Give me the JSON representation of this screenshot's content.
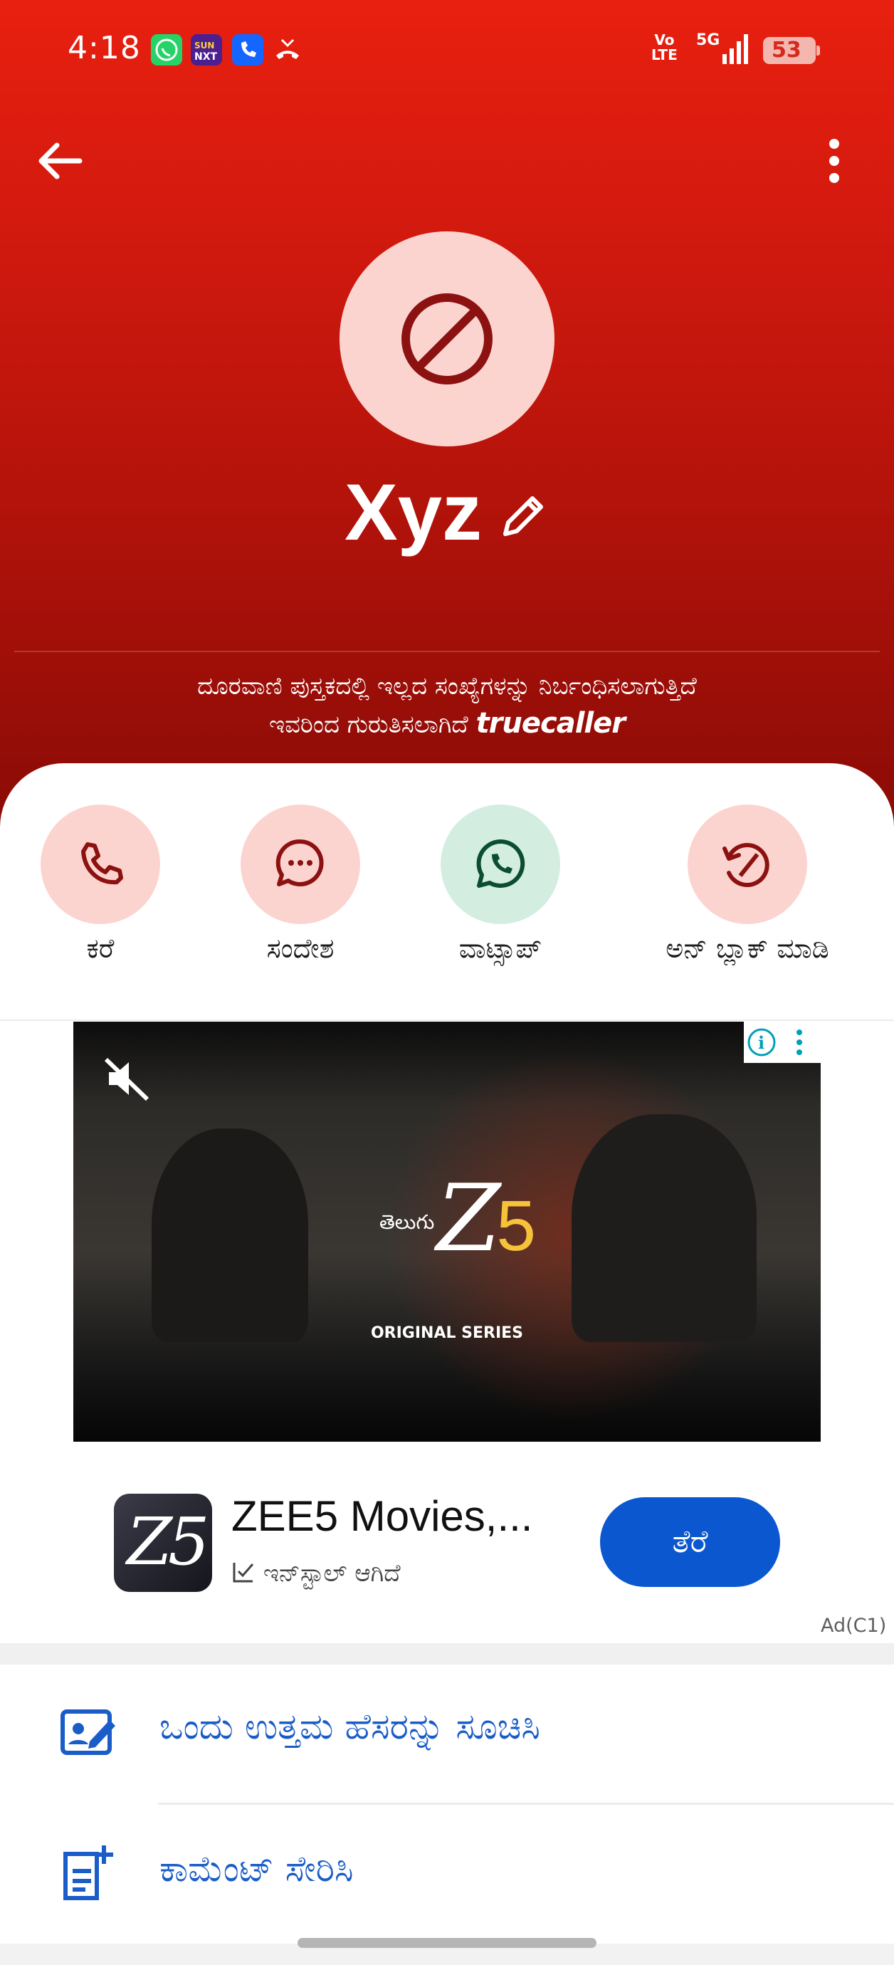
{
  "status_bar": {
    "time": "4:18",
    "network_top": "Vo",
    "network_bottom": "LTE",
    "signal": "5G",
    "battery": "53",
    "notification_icons": [
      "whatsapp-icon",
      "sun-nxt-icon",
      "truecaller-icon",
      "missed-call-icon"
    ]
  },
  "contact": {
    "name": "Xyz",
    "spam_line1": "ದೂರವಾಣಿ ಪುಸ್ತಕದಲ್ಲಿ ಇಲ್ಲದ ಸಂಖ್ಯೆಗಳನ್ನು ನಿರ್ಬಂಧಿಸಲಾಗುತ್ತಿದೆ",
    "spam_line2": "ಇವರಿಂದ ಗುರುತಿಸಲಾಗಿದೆ",
    "identified_by": "truecaller"
  },
  "actions": [
    {
      "label": "ಕರೆ",
      "icon": "phone-icon"
    },
    {
      "label": "ಸಂದೇಶ",
      "icon": "message-icon"
    },
    {
      "label": "ವಾಟ್ಸಾಪ್",
      "icon": "whatsapp-icon"
    },
    {
      "label": "ಅನ್ ಬ್ಲಾಕ್ ಮಾಡಿ",
      "icon": "unblock-icon"
    }
  ],
  "ad": {
    "video_language": "తెలుగు",
    "video_series": "ORIGINAL SERIES",
    "app_name": "ZEE5 Movies,...",
    "install_status": "ಇನ್‌ಸ್ಟಾಲ್ ಆಗಿದೆ",
    "open_button": "ತೆರೆ",
    "ad_tag": "Ad(C1)"
  },
  "options": [
    {
      "label": "ಒಂದು ಉತ್ತಮ ಹೆಸರನ್ನು ಸೂಚಿಸಿ",
      "icon": "suggest-name-icon"
    },
    {
      "label": "ಕಾಮೆಂಟ್ ಸೇರಿಸಿ",
      "icon": "add-comment-icon"
    }
  ],
  "colors": {
    "header": "#d51a0f",
    "accent_blue": "#0b57d0",
    "action_red_bg": "#fcd4cf",
    "action_green_bg": "#d4ede1"
  }
}
